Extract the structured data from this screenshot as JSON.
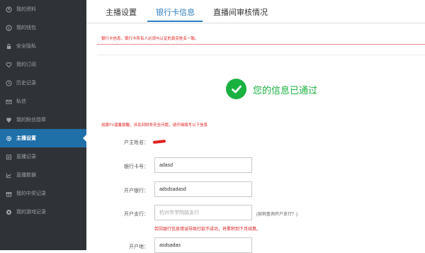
{
  "sidebar": {
    "items": [
      {
        "label": "我的资料",
        "icon": "user-icon"
      },
      {
        "label": "我的钱包",
        "icon": "wallet-icon"
      },
      {
        "label": "安全隐私",
        "icon": "lock-icon"
      },
      {
        "label": "我的订阅",
        "icon": "heart-icon"
      },
      {
        "label": "历史记录",
        "icon": "clock-icon"
      },
      {
        "label": "私信",
        "icon": "mail-icon"
      },
      {
        "label": "我的粉丝勋章",
        "icon": "medal-icon"
      },
      {
        "label": "主播设置",
        "icon": "gear-icon",
        "active": true
      },
      {
        "label": "直播记录",
        "icon": "record-icon"
      },
      {
        "label": "直播数据",
        "icon": "chart-icon"
      },
      {
        "label": "我的中奖记录",
        "icon": "gift-icon"
      },
      {
        "label": "我的游戏记录",
        "icon": "game-icon"
      }
    ]
  },
  "tabs": [
    {
      "label": "主播设置"
    },
    {
      "label": "银行卡信息",
      "active": true
    },
    {
      "label": "直播间审核情况"
    }
  ],
  "notice": "银行卡信息，银行卡所有人必须与认证的真实姓名一致。",
  "success_text": "您的信息已通过",
  "warning": "战旗TV温馨提醒，涉及到财务安全问题，请仔细填写以下信息",
  "form": {
    "owner_label": "户主姓名：",
    "card_label": "银行卡号：",
    "card_value": "adasd",
    "bank_label": "开户银行：",
    "bank_value": "adsdsadasd",
    "branch_label": "开户支行：",
    "branch_placeholder": "杭州市学院路支行",
    "branch_hint": "(如何查询开户支行？)",
    "branch_error": "若因银行信息错误导致打款不成功，将累积到下月结算。",
    "address_label": "开户地：",
    "address_value": "asdsadas"
  },
  "colors": {
    "sidebar_bg": "#2f3338",
    "active_item": "#1f6fa8",
    "tab_active": "#2f7fc1",
    "success": "#1ab140",
    "warning": "#e02020"
  }
}
